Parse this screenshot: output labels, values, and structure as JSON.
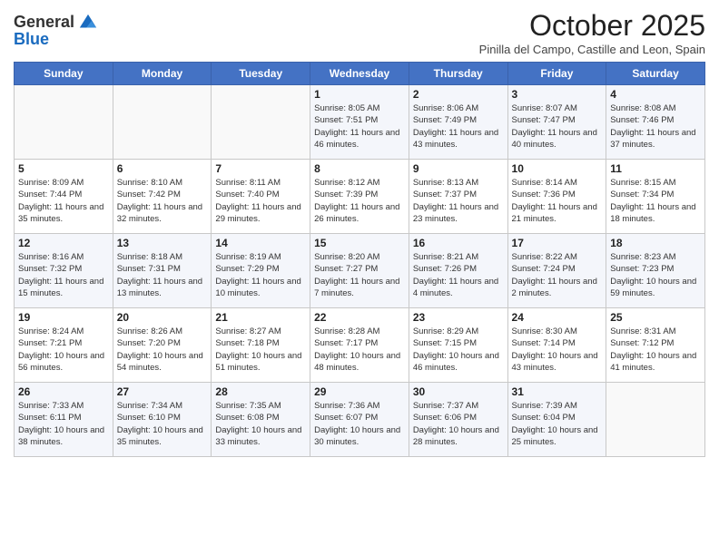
{
  "logo": {
    "general": "General",
    "blue": "Blue"
  },
  "header": {
    "month": "October 2025",
    "location": "Pinilla del Campo, Castille and Leon, Spain"
  },
  "days_of_week": [
    "Sunday",
    "Monday",
    "Tuesday",
    "Wednesday",
    "Thursday",
    "Friday",
    "Saturday"
  ],
  "weeks": [
    [
      {
        "day": "",
        "info": ""
      },
      {
        "day": "",
        "info": ""
      },
      {
        "day": "",
        "info": ""
      },
      {
        "day": "1",
        "info": "Sunrise: 8:05 AM\nSunset: 7:51 PM\nDaylight: 11 hours and 46 minutes."
      },
      {
        "day": "2",
        "info": "Sunrise: 8:06 AM\nSunset: 7:49 PM\nDaylight: 11 hours and 43 minutes."
      },
      {
        "day": "3",
        "info": "Sunrise: 8:07 AM\nSunset: 7:47 PM\nDaylight: 11 hours and 40 minutes."
      },
      {
        "day": "4",
        "info": "Sunrise: 8:08 AM\nSunset: 7:46 PM\nDaylight: 11 hours and 37 minutes."
      }
    ],
    [
      {
        "day": "5",
        "info": "Sunrise: 8:09 AM\nSunset: 7:44 PM\nDaylight: 11 hours and 35 minutes."
      },
      {
        "day": "6",
        "info": "Sunrise: 8:10 AM\nSunset: 7:42 PM\nDaylight: 11 hours and 32 minutes."
      },
      {
        "day": "7",
        "info": "Sunrise: 8:11 AM\nSunset: 7:40 PM\nDaylight: 11 hours and 29 minutes."
      },
      {
        "day": "8",
        "info": "Sunrise: 8:12 AM\nSunset: 7:39 PM\nDaylight: 11 hours and 26 minutes."
      },
      {
        "day": "9",
        "info": "Sunrise: 8:13 AM\nSunset: 7:37 PM\nDaylight: 11 hours and 23 minutes."
      },
      {
        "day": "10",
        "info": "Sunrise: 8:14 AM\nSunset: 7:36 PM\nDaylight: 11 hours and 21 minutes."
      },
      {
        "day": "11",
        "info": "Sunrise: 8:15 AM\nSunset: 7:34 PM\nDaylight: 11 hours and 18 minutes."
      }
    ],
    [
      {
        "day": "12",
        "info": "Sunrise: 8:16 AM\nSunset: 7:32 PM\nDaylight: 11 hours and 15 minutes."
      },
      {
        "day": "13",
        "info": "Sunrise: 8:18 AM\nSunset: 7:31 PM\nDaylight: 11 hours and 13 minutes."
      },
      {
        "day": "14",
        "info": "Sunrise: 8:19 AM\nSunset: 7:29 PM\nDaylight: 11 hours and 10 minutes."
      },
      {
        "day": "15",
        "info": "Sunrise: 8:20 AM\nSunset: 7:27 PM\nDaylight: 11 hours and 7 minutes."
      },
      {
        "day": "16",
        "info": "Sunrise: 8:21 AM\nSunset: 7:26 PM\nDaylight: 11 hours and 4 minutes."
      },
      {
        "day": "17",
        "info": "Sunrise: 8:22 AM\nSunset: 7:24 PM\nDaylight: 11 hours and 2 minutes."
      },
      {
        "day": "18",
        "info": "Sunrise: 8:23 AM\nSunset: 7:23 PM\nDaylight: 10 hours and 59 minutes."
      }
    ],
    [
      {
        "day": "19",
        "info": "Sunrise: 8:24 AM\nSunset: 7:21 PM\nDaylight: 10 hours and 56 minutes."
      },
      {
        "day": "20",
        "info": "Sunrise: 8:26 AM\nSunset: 7:20 PM\nDaylight: 10 hours and 54 minutes."
      },
      {
        "day": "21",
        "info": "Sunrise: 8:27 AM\nSunset: 7:18 PM\nDaylight: 10 hours and 51 minutes."
      },
      {
        "day": "22",
        "info": "Sunrise: 8:28 AM\nSunset: 7:17 PM\nDaylight: 10 hours and 48 minutes."
      },
      {
        "day": "23",
        "info": "Sunrise: 8:29 AM\nSunset: 7:15 PM\nDaylight: 10 hours and 46 minutes."
      },
      {
        "day": "24",
        "info": "Sunrise: 8:30 AM\nSunset: 7:14 PM\nDaylight: 10 hours and 43 minutes."
      },
      {
        "day": "25",
        "info": "Sunrise: 8:31 AM\nSunset: 7:12 PM\nDaylight: 10 hours and 41 minutes."
      }
    ],
    [
      {
        "day": "26",
        "info": "Sunrise: 7:33 AM\nSunset: 6:11 PM\nDaylight: 10 hours and 38 minutes."
      },
      {
        "day": "27",
        "info": "Sunrise: 7:34 AM\nSunset: 6:10 PM\nDaylight: 10 hours and 35 minutes."
      },
      {
        "day": "28",
        "info": "Sunrise: 7:35 AM\nSunset: 6:08 PM\nDaylight: 10 hours and 33 minutes."
      },
      {
        "day": "29",
        "info": "Sunrise: 7:36 AM\nSunset: 6:07 PM\nDaylight: 10 hours and 30 minutes."
      },
      {
        "day": "30",
        "info": "Sunrise: 7:37 AM\nSunset: 6:06 PM\nDaylight: 10 hours and 28 minutes."
      },
      {
        "day": "31",
        "info": "Sunrise: 7:39 AM\nSunset: 6:04 PM\nDaylight: 10 hours and 25 minutes."
      },
      {
        "day": "",
        "info": ""
      }
    ]
  ]
}
